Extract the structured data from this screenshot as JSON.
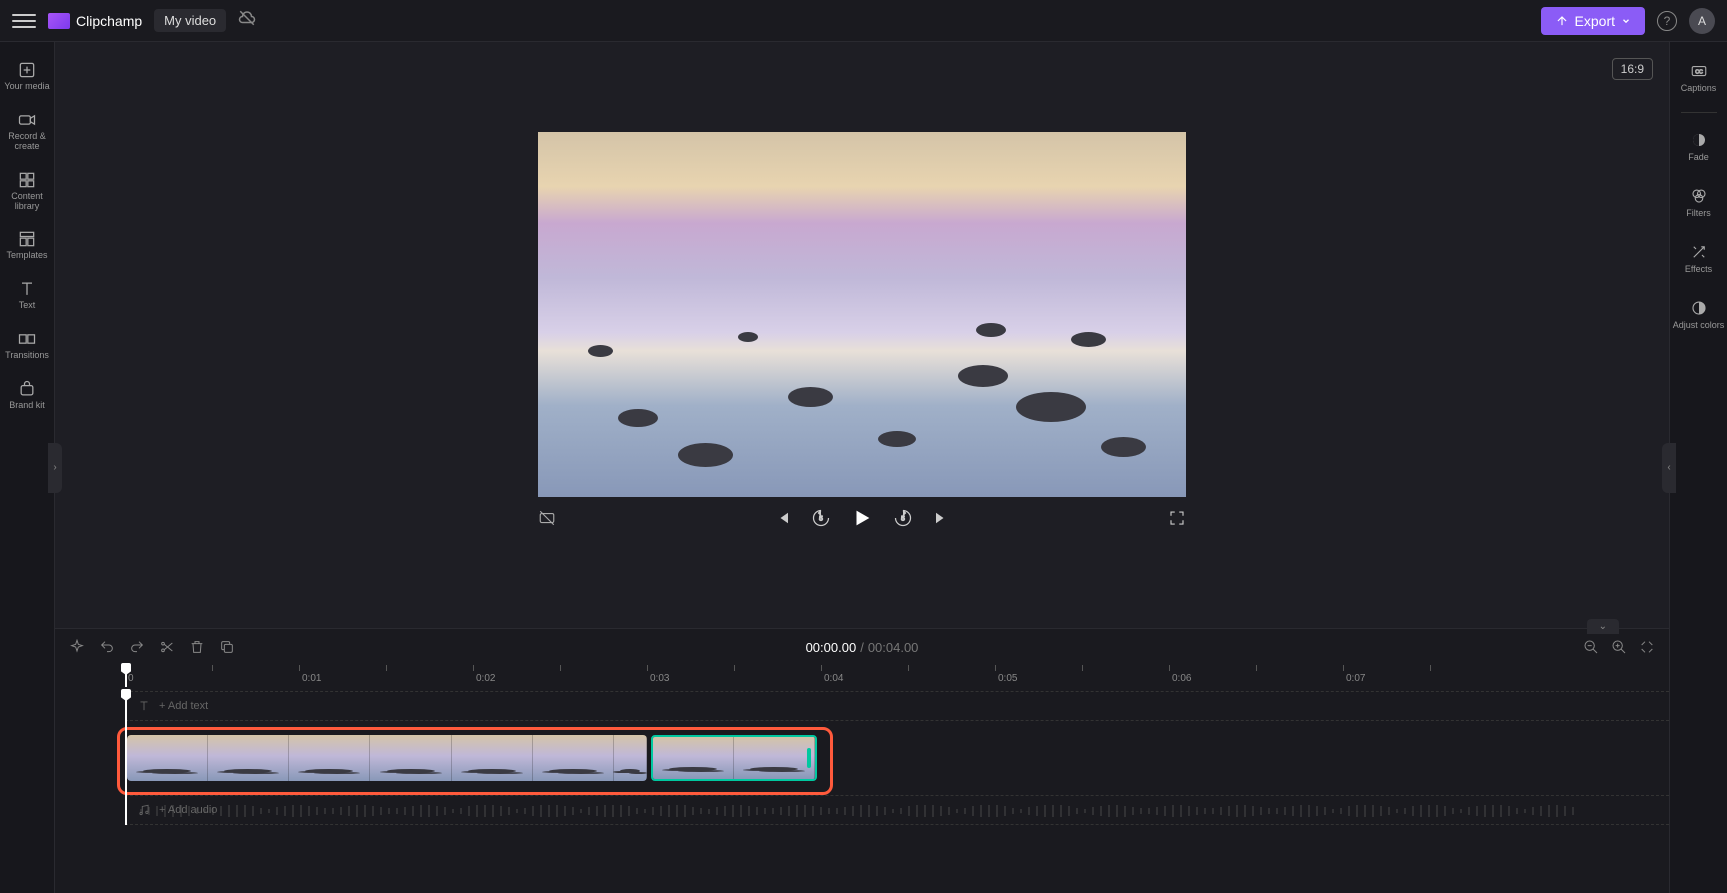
{
  "app": {
    "name": "Clipchamp",
    "title": "My video"
  },
  "topbar": {
    "export_label": "Export",
    "avatar_initial": "A"
  },
  "left_sidebar": {
    "items": [
      {
        "label": "Your media",
        "icon": "plus-box-icon"
      },
      {
        "label": "Record & create",
        "icon": "camera-icon"
      },
      {
        "label": "Content library",
        "icon": "library-icon"
      },
      {
        "label": "Templates",
        "icon": "template-icon"
      },
      {
        "label": "Text",
        "icon": "text-icon"
      },
      {
        "label": "Transitions",
        "icon": "transitions-icon"
      },
      {
        "label": "Brand kit",
        "icon": "brandkit-icon"
      }
    ]
  },
  "right_sidebar": {
    "items": [
      {
        "label": "Captions",
        "icon": "captions-icon"
      },
      {
        "label": "Fade",
        "icon": "fade-icon"
      },
      {
        "label": "Filters",
        "icon": "filters-icon"
      },
      {
        "label": "Effects",
        "icon": "effects-icon"
      },
      {
        "label": "Adjust colors",
        "icon": "adjust-colors-icon"
      }
    ]
  },
  "preview": {
    "aspect_ratio": "16:9"
  },
  "playback": {
    "current_time": "00:00.00",
    "separator": "/",
    "total_time": "00:04.00"
  },
  "ruler": {
    "start": "0",
    "marks": [
      "0:01",
      "0:02",
      "0:03",
      "0:04",
      "0:05",
      "0:06",
      "0:07"
    ]
  },
  "tracks": {
    "text_placeholder": "+ Add text",
    "audio_placeholder": "+ Add audio"
  },
  "colors": {
    "accent": "#8b5cf6",
    "highlight": "#ff5a3c",
    "selection": "#00c8a0"
  }
}
